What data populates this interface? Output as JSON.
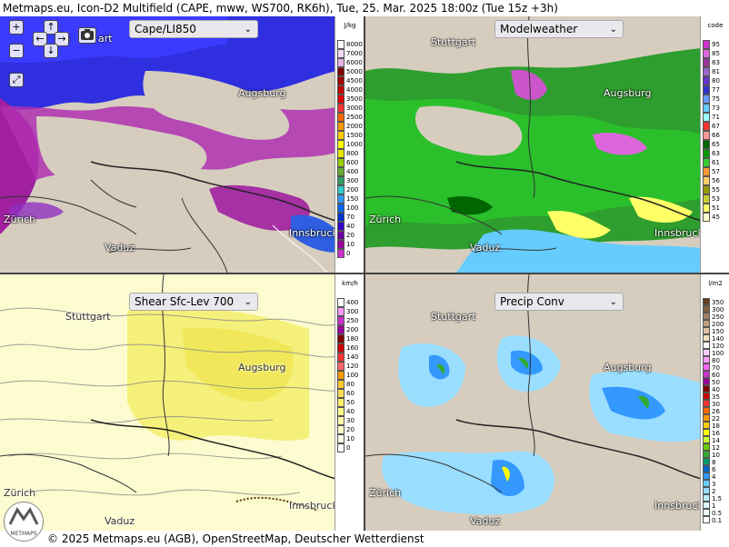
{
  "title": "Metmaps.eu, Icon-D2 Multifield (CAPE, mww, WS700, RK6h), Tue, 25. Mar. 2025 18:00z (Tue 15z +3h)",
  "footer": "© 2025 Metmaps.eu (AGB), OpenStreetMap, Deutscher Wetterdienst",
  "logo_text": "METMAPS",
  "controls": {
    "zoom_in": "+",
    "zoom_out": "−",
    "fullscreen": "⤢",
    "camera": "📷",
    "pan_up": "↑",
    "pan_down": "↓",
    "pan_left": "←",
    "pan_right": "→",
    "stuttgart_partial": "S",
    "art_partial": "art"
  },
  "cities": {
    "stuttgart": "Stuttgart",
    "augsburg": "Augsburg",
    "zurich": "Zürich",
    "vaduz": "Vaduz",
    "innsbruck": "Innsbruck"
  },
  "panels": [
    {
      "name": "cape",
      "dropdown": "Cape/LI850",
      "unit": "J/kg",
      "scale": [
        {
          "label": "8000",
          "color": "#ffffff"
        },
        {
          "label": "7000",
          "color": "#f2d9f2"
        },
        {
          "label": "6000",
          "color": "#e6b3e6"
        },
        {
          "label": "5000",
          "color": "#800000"
        },
        {
          "label": "4500",
          "color": "#a00000"
        },
        {
          "label": "4000",
          "color": "#c00000"
        },
        {
          "label": "3500",
          "color": "#e00000"
        },
        {
          "label": "3000",
          "color": "#ff3333"
        },
        {
          "label": "2500",
          "color": "#ff6600"
        },
        {
          "label": "2000",
          "color": "#ff9900"
        },
        {
          "label": "1500",
          "color": "#ffcc00"
        },
        {
          "label": "1000",
          "color": "#ffff00"
        },
        {
          "label": "800",
          "color": "#e6e600"
        },
        {
          "label": "600",
          "color": "#99cc00"
        },
        {
          "label": "400",
          "color": "#66aa33"
        },
        {
          "label": "300",
          "color": "#339966"
        },
        {
          "label": "200",
          "color": "#33cccc"
        },
        {
          "label": "150",
          "color": "#3399ff"
        },
        {
          "label": "100",
          "color": "#0066ff"
        },
        {
          "label": "70",
          "color": "#0033cc"
        },
        {
          "label": "40",
          "color": "#3300cc"
        },
        {
          "label": "20",
          "color": "#660099"
        },
        {
          "label": "10",
          "color": "#990099"
        },
        {
          "label": "0",
          "color": "#cc33cc"
        }
      ]
    },
    {
      "name": "modelweather",
      "dropdown": "Modelweather",
      "unit": "code",
      "scale": [
        {
          "label": "95",
          "color": "#cc33cc"
        },
        {
          "label": "85",
          "color": "#e066e0"
        },
        {
          "label": "83",
          "color": "#993399"
        },
        {
          "label": "81",
          "color": "#9966cc"
        },
        {
          "label": "80",
          "color": "#6633cc"
        },
        {
          "label": "77",
          "color": "#3333cc"
        },
        {
          "label": "75",
          "color": "#6699ff"
        },
        {
          "label": "73",
          "color": "#66ccff"
        },
        {
          "label": "71",
          "color": "#99ffff"
        },
        {
          "label": "67",
          "color": "#ff3333"
        },
        {
          "label": "66",
          "color": "#ff9999"
        },
        {
          "label": "65",
          "color": "#006600"
        },
        {
          "label": "63",
          "color": "#009900"
        },
        {
          "label": "61",
          "color": "#33cc33"
        },
        {
          "label": "57",
          "color": "#ff9933"
        },
        {
          "label": "56",
          "color": "#ffcc66"
        },
        {
          "label": "55",
          "color": "#999900"
        },
        {
          "label": "53",
          "color": "#cccc33"
        },
        {
          "label": "51",
          "color": "#ffff66"
        },
        {
          "label": "45",
          "color": "#ffffcc"
        }
      ]
    },
    {
      "name": "shear",
      "dropdown": "Shear Sfc-Lev 700",
      "unit": "km/h",
      "scale": [
        {
          "label": "400",
          "color": "#ffffff"
        },
        {
          "label": "300",
          "color": "#ff99ff"
        },
        {
          "label": "250",
          "color": "#cc33cc"
        },
        {
          "label": "200",
          "color": "#990099"
        },
        {
          "label": "180",
          "color": "#800000"
        },
        {
          "label": "160",
          "color": "#cc0000"
        },
        {
          "label": "140",
          "color": "#ff3333"
        },
        {
          "label": "120",
          "color": "#ff6666"
        },
        {
          "label": "100",
          "color": "#ff9900"
        },
        {
          "label": "80",
          "color": "#ffcc33"
        },
        {
          "label": "60",
          "color": "#ffdd55"
        },
        {
          "label": "50",
          "color": "#ffee66"
        },
        {
          "label": "40",
          "color": "#ffff88"
        },
        {
          "label": "30",
          "color": "#ffffaa"
        },
        {
          "label": "20",
          "color": "#ffffcc"
        },
        {
          "label": "10",
          "color": "#ffffee"
        },
        {
          "label": "0",
          "color": "#ffffff"
        }
      ]
    },
    {
      "name": "precip",
      "dropdown": "Precip Conv",
      "unit": "l/m2",
      "scale": [
        {
          "label": "350",
          "color": "#604020"
        },
        {
          "label": "300",
          "color": "#806040"
        },
        {
          "label": "250",
          "color": "#a08060"
        },
        {
          "label": "200",
          "color": "#c0a080"
        },
        {
          "label": "150",
          "color": "#e0c0a0"
        },
        {
          "label": "140",
          "color": "#f0e0c0"
        },
        {
          "label": "120",
          "color": "#ffffff"
        },
        {
          "label": "100",
          "color": "#ffccff"
        },
        {
          "label": "80",
          "color": "#ff99ff"
        },
        {
          "label": "70",
          "color": "#ff66ff"
        },
        {
          "label": "60",
          "color": "#cc33cc"
        },
        {
          "label": "50",
          "color": "#990099"
        },
        {
          "label": "40",
          "color": "#800000"
        },
        {
          "label": "35",
          "color": "#cc0000"
        },
        {
          "label": "30",
          "color": "#ff3333"
        },
        {
          "label": "26",
          "color": "#ff6600"
        },
        {
          "label": "22",
          "color": "#ff9900"
        },
        {
          "label": "18",
          "color": "#ffcc00"
        },
        {
          "label": "16",
          "color": "#ffff00"
        },
        {
          "label": "14",
          "color": "#ccff33"
        },
        {
          "label": "12",
          "color": "#66cc00"
        },
        {
          "label": "10",
          "color": "#33aa33"
        },
        {
          "label": "8",
          "color": "#009966"
        },
        {
          "label": "6",
          "color": "#0066cc"
        },
        {
          "label": "4",
          "color": "#3399ff"
        },
        {
          "label": "3",
          "color": "#66ccff"
        },
        {
          "label": "2",
          "color": "#99ddff"
        },
        {
          "label": "1.5",
          "color": "#bbeeff"
        },
        {
          "label": "1",
          "color": "#ddf6ff"
        },
        {
          "label": "0.5",
          "color": "#eefbff"
        },
        {
          "label": "0.1",
          "color": "#ffffff"
        }
      ]
    }
  ]
}
